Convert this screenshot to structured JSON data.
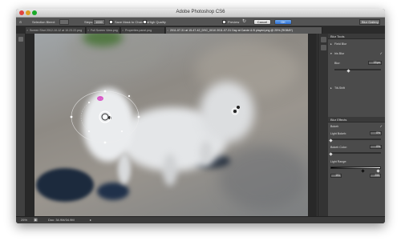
{
  "window": {
    "title": "Adobe Photoshop CS6"
  },
  "options_bar": {
    "selection_bleed_label": "Selection Bleed:",
    "selection_bleed_value": "",
    "steps_label": "Steps:",
    "steps_value": "1000",
    "save_mask_label": "Save Mask to Channels",
    "high_quality_label": "High Quality",
    "preview_label": "Preview",
    "cancel_label": "Cancel",
    "ok_label": "OK",
    "workspace_label": "Blur Gallery"
  },
  "tabs": [
    {
      "label": "Screen Shot 2012-10-12 at 10.23.22.png",
      "active": false
    },
    {
      "label": "Full Screen View.png",
      "active": false
    },
    {
      "label": "Properties panel.png",
      "active": false
    },
    {
      "label": "2011-07-31 at 15-47-42_DSC_0010 2011-07-31 Day at Carole & B played.png @ 25% (RGB/8*)",
      "active": true
    }
  ],
  "blur_tools": {
    "header": "Blur Tools",
    "field_blur_label": "Field Blur",
    "iris_blur_label": "Iris Blur",
    "blur_label": "Blur:",
    "blur_value": "15 px",
    "blur_level": 0.3,
    "tilt_shift_label": "Tilt-Shift"
  },
  "blur_effects": {
    "header": "Blur Effects",
    "bokeh_label": "Bokeh",
    "light_bokeh_label": "Light Bokeh:",
    "light_bokeh_value": "0%",
    "bokeh_color_label": "Bokeh Color:",
    "bokeh_color_value": "0%",
    "light_range_label": "Light Range:",
    "light_range_low": "191",
    "light_range_high": "255"
  },
  "status_bar": {
    "zoom": "25%",
    "doc_size": "Doc: 34.9M/34.9M"
  },
  "colors": {
    "accent": "#2f6fd1",
    "panel_bg": "#4b4b4b",
    "canvas_bg": "#282828"
  },
  "icons": [
    "pin-icon",
    "rotate-icon",
    "checkbox-icon",
    "arrow-icon",
    "chevron-icon"
  ]
}
